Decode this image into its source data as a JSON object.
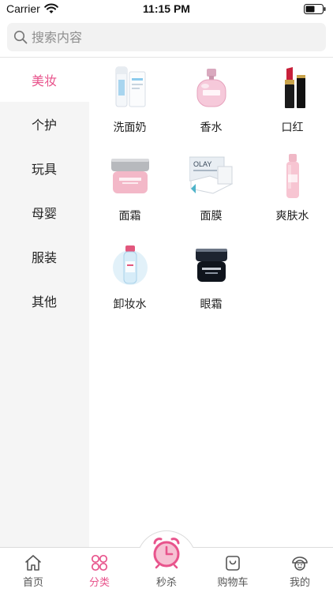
{
  "status_bar": {
    "carrier": "Carrier",
    "time": "11:15 PM"
  },
  "search": {
    "placeholder": "搜索内容",
    "value": ""
  },
  "categories": [
    {
      "label": "美妆",
      "active": true
    },
    {
      "label": "个护",
      "active": false
    },
    {
      "label": "玩具",
      "active": false
    },
    {
      "label": "母婴",
      "active": false
    },
    {
      "label": "服装",
      "active": false
    },
    {
      "label": "其他",
      "active": false
    }
  ],
  "products": [
    {
      "name": "洗面奶",
      "icon": "cleanser-icon"
    },
    {
      "name": "香水",
      "icon": "perfume-icon"
    },
    {
      "name": "口红",
      "icon": "lipstick-icon"
    },
    {
      "name": "面霜",
      "icon": "face-cream-icon"
    },
    {
      "name": "面膜",
      "icon": "face-mask-icon"
    },
    {
      "name": "爽肤水",
      "icon": "toner-icon"
    },
    {
      "name": "卸妆水",
      "icon": "makeup-remover-icon"
    },
    {
      "name": "眼霜",
      "icon": "eye-cream-icon"
    }
  ],
  "product_labels": {
    "face_mask_brand": "OLAY"
  },
  "tabs": [
    {
      "label": "首页",
      "icon": "home-icon",
      "active": false
    },
    {
      "label": "分类",
      "icon": "category-icon",
      "active": true
    },
    {
      "label": "秒杀",
      "icon": "alarm-clock-icon",
      "active": false
    },
    {
      "label": "购物车",
      "icon": "shopping-bag-icon",
      "active": false
    },
    {
      "label": "我的",
      "icon": "profile-icon",
      "active": false
    }
  ],
  "colors": {
    "accent": "#e8548c",
    "sidebar_bg": "#f5f5f5",
    "search_bg": "#f2f2f2"
  }
}
